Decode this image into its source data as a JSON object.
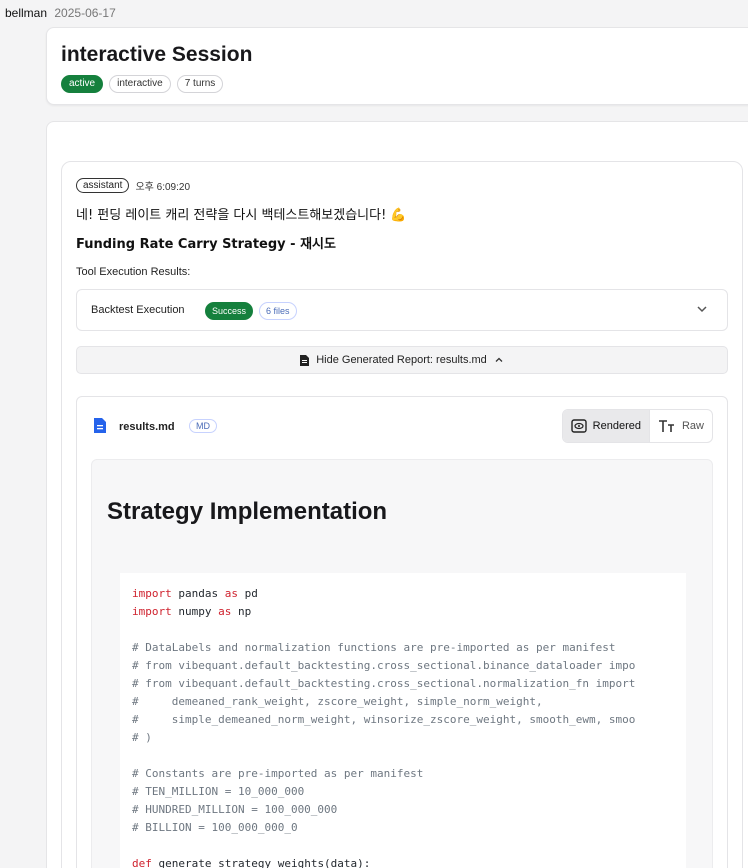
{
  "header": {
    "user": "bellman",
    "date": "2025-06-17"
  },
  "session": {
    "title": "interactive Session",
    "badges": [
      "active",
      "interactive",
      "7 turns"
    ]
  },
  "message": {
    "role": "assistant",
    "time": "오후 6:09:20",
    "intro": "네! 펀딩 레이트 캐리 전략을 다시 백테스트해보겠습니다! 💪",
    "strategy_title": "Funding Rate Carry Strategy - 재시도",
    "tool_results_label": "Tool Execution Results:",
    "execution": {
      "name": "Backtest Execution",
      "status": "Success",
      "files": "6 files"
    },
    "hide_report": "Hide Generated Report: results.md"
  },
  "file": {
    "name": "results.md",
    "type": "MD",
    "view_rendered": "Rendered",
    "view_raw": "Raw"
  },
  "doc": {
    "heading": "Strategy Implementation",
    "code_lines": [
      {
        "kind": "import",
        "kw": "import",
        "rest": " pandas ",
        "kw2": "as",
        "rest2": " pd"
      },
      {
        "kind": "import",
        "kw": "import",
        "rest": " numpy ",
        "kw2": "as",
        "rest2": " np"
      },
      {
        "kind": "blank",
        "text": ""
      },
      {
        "kind": "comment",
        "text": "# DataLabels and normalization functions are pre-imported as per manifest"
      },
      {
        "kind": "comment",
        "text": "# from vibequant.default_backtesting.cross_sectional.binance_dataloader impo"
      },
      {
        "kind": "comment",
        "text": "# from vibequant.default_backtesting.cross_sectional.normalization_fn import"
      },
      {
        "kind": "comment",
        "text": "#     demeaned_rank_weight, zscore_weight, simple_norm_weight,"
      },
      {
        "kind": "comment",
        "text": "#     simple_demeaned_norm_weight, winsorize_zscore_weight, smooth_ewm, smoo"
      },
      {
        "kind": "comment",
        "text": "# )"
      },
      {
        "kind": "blank",
        "text": ""
      },
      {
        "kind": "comment",
        "text": "# Constants are pre-imported as per manifest"
      },
      {
        "kind": "comment",
        "text": "# TEN_MILLION = 10_000_000"
      },
      {
        "kind": "comment",
        "text": "# HUNDRED_MILLION = 100_000_000"
      },
      {
        "kind": "comment",
        "text": "# BILLION = 100_000_000_0"
      },
      {
        "kind": "blank",
        "text": ""
      },
      {
        "kind": "def",
        "kw": "def",
        "rest": " generate_strategy_weights(data):"
      }
    ]
  }
}
